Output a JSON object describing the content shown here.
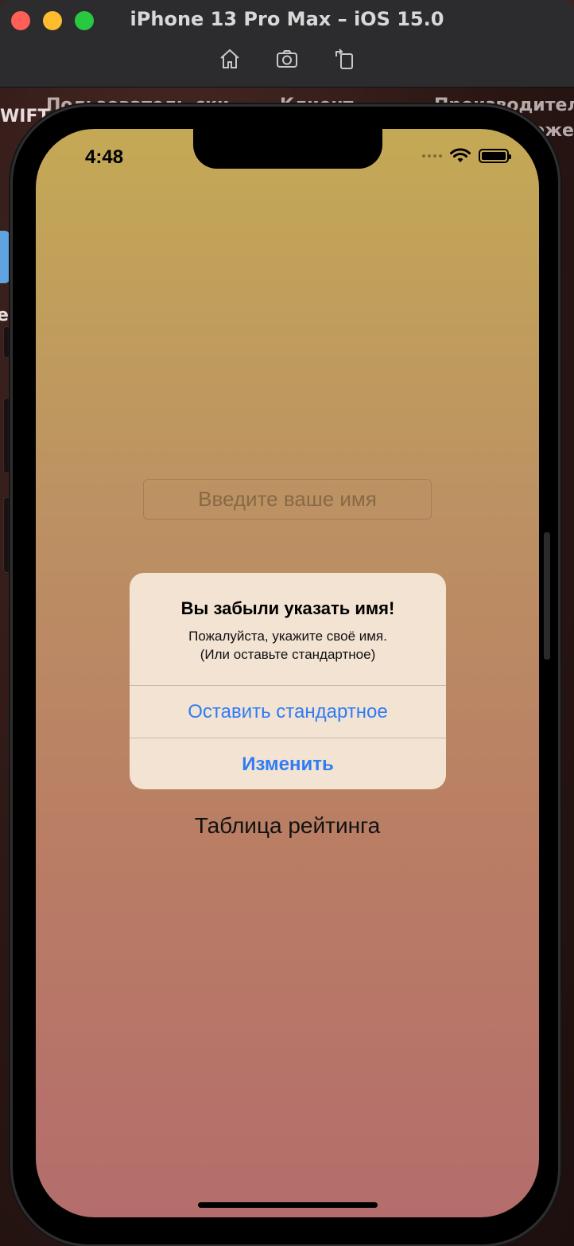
{
  "simulator": {
    "title": "iPhone 13 Pro Max – iOS 15.0",
    "toolbar": [
      {
        "icon": "home-icon"
      },
      {
        "icon": "camera-icon"
      },
      {
        "icon": "rotate-icon"
      }
    ]
  },
  "desktop": {
    "labels": [
      "WIFT",
      "Пользователь-ски",
      "Клиент",
      "Производител",
      "ожен",
      "ер"
    ]
  },
  "status_bar": {
    "time": "4:48"
  },
  "screen": {
    "name_placeholder": "Введите ваше имя",
    "rating_label": "Таблица рейтинга"
  },
  "alert": {
    "title": "Вы забыли указать имя!",
    "message": "Пожалуйста, укажите своё имя.\n(Или оставьте стандартное)",
    "actions": [
      "Оставить стандартное",
      "Изменить"
    ]
  },
  "colors": {
    "accent": "#2f7cf6",
    "background_top": "#c4a955",
    "background_bottom": "#b46d6c",
    "alert_background": "#f3e3d3"
  }
}
